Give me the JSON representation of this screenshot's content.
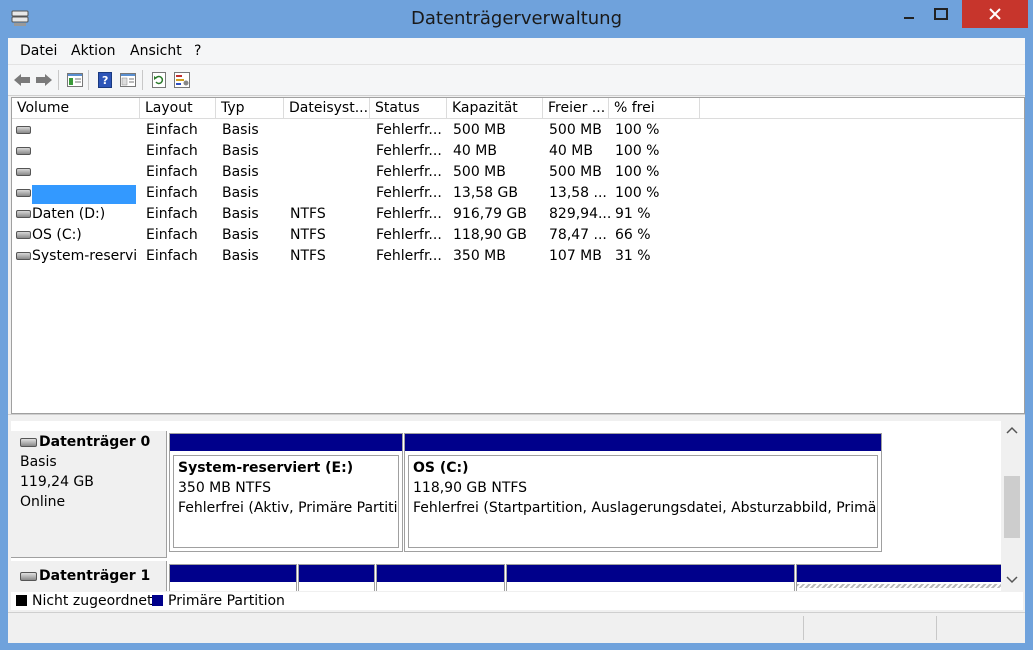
{
  "window": {
    "title": "Datenträgerverwaltung"
  },
  "menu": [
    "Datei",
    "Aktion",
    "Ansicht",
    "?"
  ],
  "toolbar": [
    "back-icon",
    "forward-icon",
    "console-tree-icon",
    "help-icon",
    "properties-icon",
    "refresh-icon",
    "settings-icon"
  ],
  "columns": [
    "Volume",
    "Layout",
    "Typ",
    "Dateisyst...",
    "Status",
    "Kapazität",
    "Freier ...",
    "% frei"
  ],
  "volumes": [
    {
      "name": "",
      "layout": "Einfach",
      "type": "Basis",
      "fs": "",
      "status": "Fehlerfr...",
      "capacity": "500 MB",
      "free": "500 MB",
      "pct": "100 %"
    },
    {
      "name": "",
      "layout": "Einfach",
      "type": "Basis",
      "fs": "",
      "status": "Fehlerfr...",
      "capacity": "40 MB",
      "free": "40 MB",
      "pct": "100 %"
    },
    {
      "name": "",
      "layout": "Einfach",
      "type": "Basis",
      "fs": "",
      "status": "Fehlerfr...",
      "capacity": "500 MB",
      "free": "500 MB",
      "pct": "100 %"
    },
    {
      "name": "",
      "layout": "Einfach",
      "type": "Basis",
      "fs": "",
      "status": "Fehlerfr...",
      "capacity": "13,58 GB",
      "free": "13,58 ...",
      "pct": "100 %"
    },
    {
      "name": "Daten (D:)",
      "layout": "Einfach",
      "type": "Basis",
      "fs": "NTFS",
      "status": "Fehlerfr...",
      "capacity": "916,79 GB",
      "free": "829,94...",
      "pct": "91 %"
    },
    {
      "name": "OS (C:)",
      "layout": "Einfach",
      "type": "Basis",
      "fs": "NTFS",
      "status": "Fehlerfr...",
      "capacity": "118,90 GB",
      "free": "78,47 ...",
      "pct": "66 %"
    },
    {
      "name": "System-reservi...",
      "layout": "Einfach",
      "type": "Basis",
      "fs": "NTFS",
      "status": "Fehlerfr...",
      "capacity": "350 MB",
      "free": "107 MB",
      "pct": "31 %"
    }
  ],
  "disk0": {
    "title": "Datenträger 0",
    "type": "Basis",
    "size": "119,24 GB",
    "state": "Online",
    "partitions": [
      {
        "name": "System-reserviert  (E:)",
        "size": "350 MB NTFS",
        "status": "Fehlerfrei (Aktiv, Primäre Partition"
      },
      {
        "name": "OS  (C:)",
        "size": "118,90 GB NTFS",
        "status": "Fehlerfrei (Startpartition, Auslagerungsdatei, Absturzabbild, Primäre P"
      }
    ]
  },
  "disk1": {
    "title": "Datenträger 1"
  },
  "legend": {
    "unallocated": "Nicht zugeordnet",
    "primary": "Primäre Partition"
  },
  "colors": {
    "primary": "#00008b",
    "unallocated": "#000000",
    "selection": "#3399ff",
    "titlebar": "#6fa2dc",
    "close": "#c7352c"
  }
}
